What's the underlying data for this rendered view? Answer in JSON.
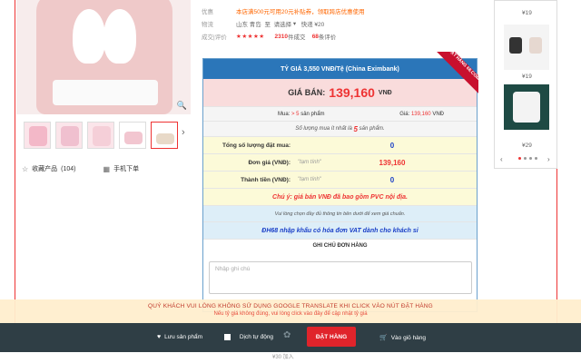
{
  "info": {
    "row1_label": "优惠",
    "row1_text": "本店满500元可用20元补贴券，领取跨店优惠使用",
    "row2_label": "物流",
    "row2_from": "山东 青岛",
    "row2_to": "至",
    "row2_select": "请选择",
    "row2_ship": "快递 ¥20",
    "row3_label": "成交|评价",
    "row3_stars": "★★★★★",
    "row3_sold_num": "2310",
    "row3_sold_text": "件成交",
    "row3_reviews_num": "68",
    "row3_reviews_text": "条评价"
  },
  "product": {
    "fav_label": "收藏产品",
    "fav_count": "(104)",
    "mobile_label": "手机下单"
  },
  "panel": {
    "header": "TỶ GIÁ 3,550 VNĐ/Tệ (China Eximbank)",
    "ribbon": "ĐẶT HÀNG 68.COM",
    "price_label": "GIÁ BÁN:",
    "price_value": "139,160",
    "price_currency": "VNĐ",
    "mua_text": "Mua:",
    "mua_min": "> 5",
    "mua_unit": "sản phẩm",
    "gia_label": "Giá:",
    "gia_value": "139,160",
    "gia_unit": "VNĐ",
    "min_note_pre": "Số lượng mua ít nhất là",
    "min_note_num": "5",
    "min_note_post": "sản phẩm.",
    "rows": [
      {
        "key": "Tổng số lượng đặt mua:",
        "mid": "",
        "value": "0"
      },
      {
        "key": "Đơn giá (VNĐ):",
        "mid": "\"tạm tính\"",
        "value": "139,160"
      },
      {
        "key": "Thành tiền (VNĐ):",
        "mid": "\"tạm tính\"",
        "value": "0"
      }
    ],
    "vat_note": "Chú ý: giá bán VNĐ đã bao gồm PVC nội địa.",
    "fill_note": "Vui lòng chọn đầy đủ thông tin bên dưới để xem giá chuẩn.",
    "import_note": "ĐH68 nhập khẩu có hóa đơn VAT dành cho khách sỉ",
    "notes_title": "GHI CHÚ ĐƠN HÀNG",
    "notes_placeholder": "Nhập ghi chú"
  },
  "right_col": {
    "price1": "¥19",
    "price2": "¥19",
    "price3": "¥29"
  },
  "warning": {
    "line1": "QUÝ KHÁCH VUI LÒNG KHÔNG SỬ DỤNG GOOGLE TRANSLATE KHI CLICK VÀO NÚT ĐẶT HÀNG",
    "line2": "Nếu tỷ giá không đúng, vui lòng click vào đây để cập nhật tỷ giá"
  },
  "bottom_bar": {
    "save_label": "Lưu sản phẩm",
    "translate_label": "Dịch tự động",
    "order_label": "ĐẶT HÀNG",
    "cart_label": "Vào giỏ hàng",
    "below_text": "¥30 加入"
  },
  "colors": {
    "accent_red": "#e33333",
    "header_blue": "#2b76b9",
    "bar_dark": "#2f3e45"
  }
}
